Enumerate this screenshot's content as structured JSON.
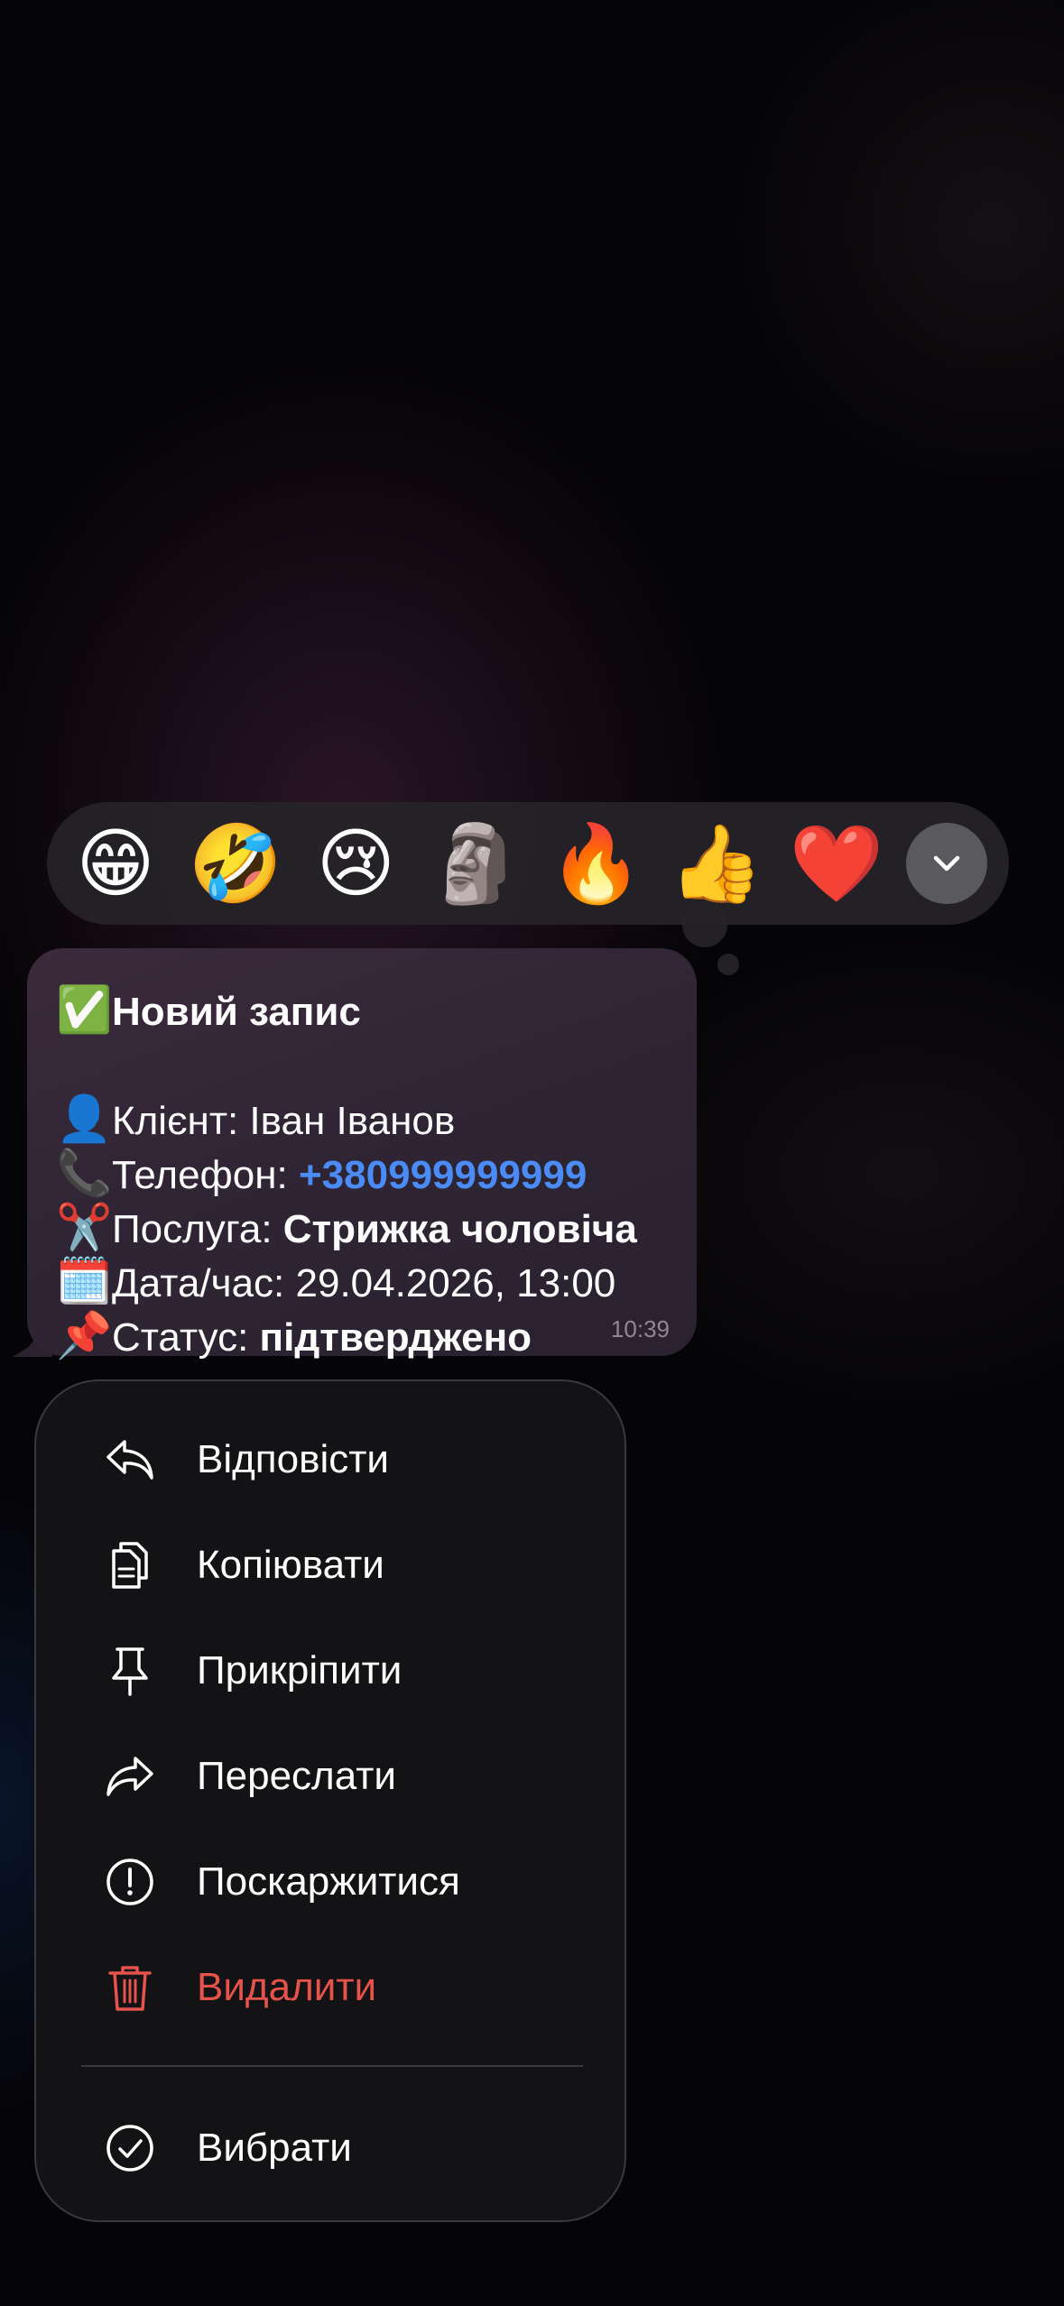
{
  "reactions": [
    {
      "emoji": "😁",
      "name": "grinning-face"
    },
    {
      "emoji": "🤣",
      "name": "rolling-on-floor-laughing"
    },
    {
      "emoji": "😢",
      "name": "crying-face"
    },
    {
      "emoji": "🗿",
      "name": "moai"
    },
    {
      "emoji": "🔥",
      "name": "fire"
    },
    {
      "emoji": "👍",
      "name": "thumbs-up"
    },
    {
      "emoji": "❤️",
      "name": "red-heart"
    }
  ],
  "message": {
    "title_emoji": "✅",
    "title": "Новий запис",
    "client_emoji": "👤",
    "client_label": "Клієнт: Іван Іванов",
    "phone_emoji": "📞",
    "phone_label": "Телефон: ",
    "phone_value": "+380999999999",
    "service_emoji": "✂️",
    "service_label": "Послуга: ",
    "service_value": "Стрижка чоловіча",
    "date_emoji": "🗓️",
    "date_label": "Дата/час: 29.04.2026, 13:00",
    "status_emoji": "📌",
    "status_label": "Статус: ",
    "status_value": "підтверджено",
    "time": "10:39"
  },
  "menu": {
    "reply": "Відповісти",
    "copy": "Копіювати",
    "pin": "Прикріпити",
    "forward": "Переслати",
    "report": "Поскаржитися",
    "delete": "Видалити",
    "select": "Вибрати"
  },
  "colors": {
    "link": "#4a8bf5",
    "destructive": "#e5534b"
  }
}
